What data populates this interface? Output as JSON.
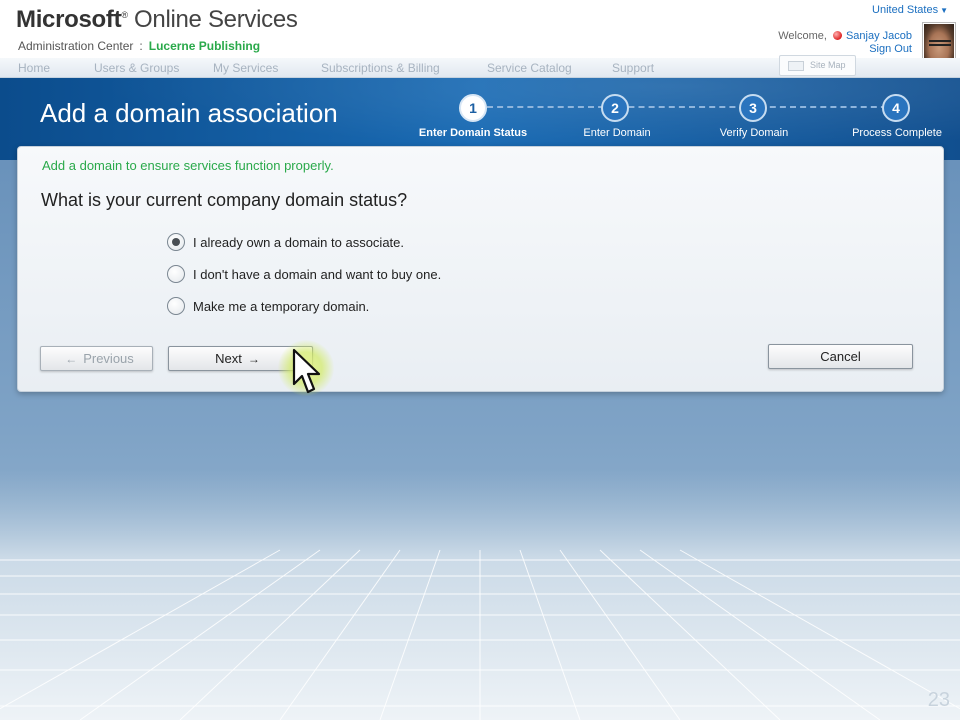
{
  "header": {
    "brand_bold": "Microsoft",
    "brand_tm": "®",
    "brand_rest": " Online Services",
    "admin_center": "Administration Center",
    "separator": ":",
    "organization": "Lucerne Publishing",
    "country": "United States",
    "welcome": "Welcome,",
    "user_name": "Sanjay Jacob",
    "sign_out": "Sign Out",
    "site_map": "Site Map"
  },
  "nav": {
    "items": [
      "Home",
      "Users & Groups",
      "My Services",
      "Subscriptions & Billing",
      "Service Catalog",
      "Support"
    ]
  },
  "wizard": {
    "title": "Add a domain association",
    "steps": [
      {
        "number": "1",
        "label": "Enter Domain Status",
        "active": true
      },
      {
        "number": "2",
        "label": "Enter Domain",
        "active": false
      },
      {
        "number": "3",
        "label": "Verify Domain",
        "active": false
      },
      {
        "number": "4",
        "label": "Process  Complete",
        "active": false
      }
    ]
  },
  "form": {
    "intro": "Add a domain to ensure services function properly.",
    "question": "What is your current company domain status?",
    "options": [
      {
        "label": "I already own a domain to associate.",
        "checked": true
      },
      {
        "label": "I don't have a domain and want to buy one.",
        "checked": false
      },
      {
        "label": "Make me a temporary domain.",
        "checked": false
      }
    ],
    "previous_label": "Previous",
    "next_label": "Next",
    "cancel_label": "Cancel"
  },
  "slide_number": "23",
  "colors": {
    "accent_green": "#2aa94a",
    "link_blue": "#1b6fc0",
    "banner_blue": "#1a6bb4"
  }
}
